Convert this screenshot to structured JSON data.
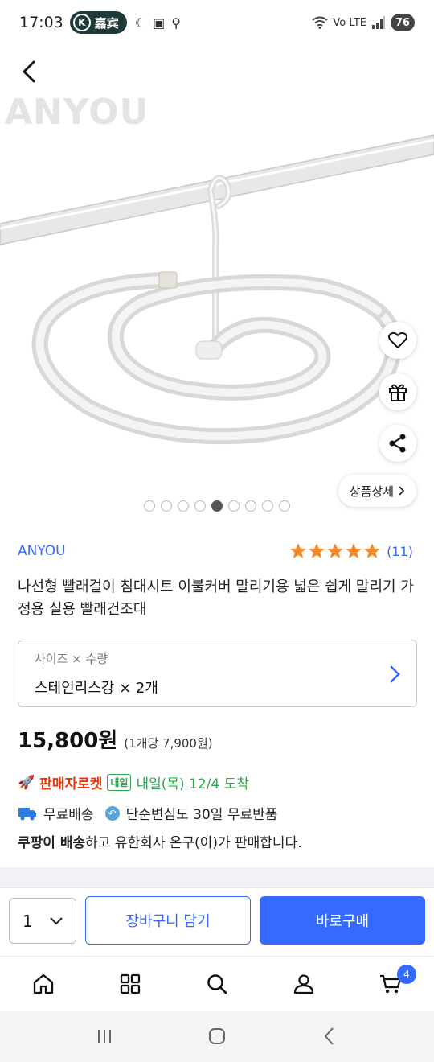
{
  "status_bar": {
    "time": "17:03",
    "kakao_letter": "K",
    "kakao_label": "嘉宾",
    "network": "Vo LTE",
    "battery": "76"
  },
  "image": {
    "watermark": "ANYOU",
    "dots_total": 9,
    "dots_active_index": 4,
    "detail_button": "상품상세"
  },
  "product": {
    "brand": "ANYOU",
    "rating_stars": 5,
    "rating_count": "(11)",
    "title": "나선형 빨래걸이 침대시트 이불커버 말리기용 넓은 쉽게 말리기 가정용 실용 빨래건조대",
    "option_label": "사이즈 × 수량",
    "option_value": "스테인리스강 × 2개",
    "price": "15,800원",
    "unit_price": "(1개당 7,900원)",
    "rocket_seller": "판매자로켓",
    "tomorrow_badge": "내일",
    "arrival": "내일(목) 12/4 도착",
    "free_shipping": "무료배송",
    "free_return": "단순변심도 30일 무료반품",
    "seller_bold": "쿠팡이 배송",
    "seller_rest": "하고 유한회사 온구(이)가 판매합니다."
  },
  "purchase_bar": {
    "quantity": "1",
    "cart_button": "장바구니 담기",
    "buy_button": "바로구매"
  },
  "bottom_nav": {
    "cart_count": "4"
  },
  "colors": {
    "accent": "#346aff",
    "star": "#f5892a",
    "rocket": "#e8360d",
    "arrival": "#2da84e"
  }
}
